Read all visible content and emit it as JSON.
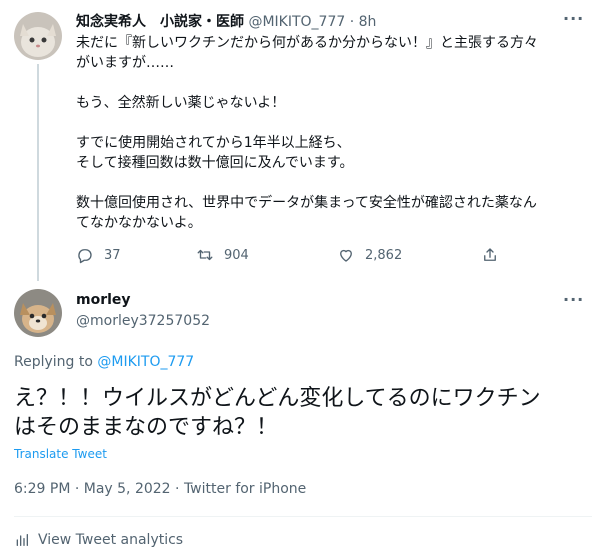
{
  "original_tweet": {
    "display_name": "知念実希人　小説家・医師",
    "handle": "@MIKITO_777",
    "separator": "·",
    "time": "8h",
    "text": "未だに『新しいワクチンだから何があるか分からない！』と主張する方々\nがいますが……\n\nもう、全然新しい薬じゃないよ！\n\nすでに使用開始されてから1年半以上経ち、\nそして接種回数は数十億回に及んでいます。\n\n数十億回使用され、世界中でデータが集まって安全性が確認された薬なん\nてなかなかないよ。",
    "replies": "37",
    "retweets": "904",
    "likes": "2,862"
  },
  "reply_tweet": {
    "display_name": "morley",
    "handle": "@morley37257052",
    "replying_to_label": "Replying to",
    "replying_to_handle": "@MIKITO_777",
    "text": "え？！！ウイルスがどんどん変化してるのにワクチン\nはそのままなのですね？！",
    "translate_label": "Translate Tweet",
    "timestamp": "6:29 PM · May 5, 2022 · Twitter for iPhone",
    "analytics_label": "View Tweet analytics"
  },
  "icons": {
    "reply": "reply-icon",
    "retweet": "retweet-icon",
    "like": "heart-icon",
    "share": "share-icon",
    "more": "more-icon",
    "analytics": "analytics-icon"
  },
  "colors": {
    "accent": "#1d9bf0",
    "muted": "#536471",
    "text": "#0f1419"
  }
}
